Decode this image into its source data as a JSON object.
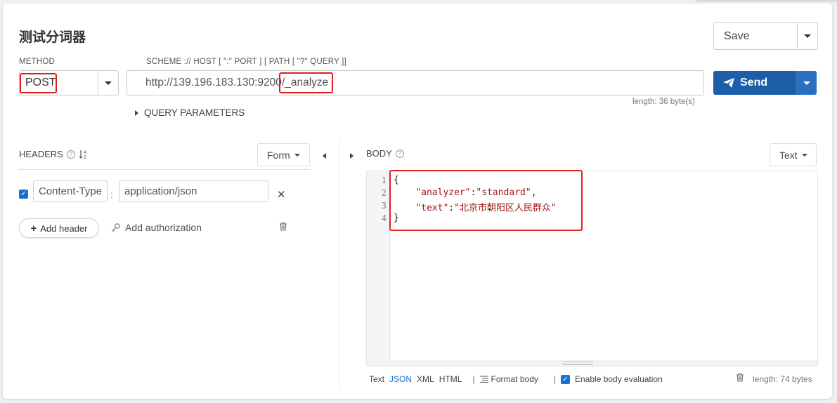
{
  "page": {
    "title": "测试分词器"
  },
  "save": {
    "label": "Save"
  },
  "method": {
    "label": "METHOD",
    "value": "POST"
  },
  "url": {
    "label": "SCHEME :// HOST [ \":\" PORT ] [ PATH [ \"?\" QUERY ]]",
    "host": "http://139.196.183.130:9200",
    "path": "/_analyze",
    "length": "length: 36 byte(s)"
  },
  "send": {
    "label": "Send"
  },
  "query_params": {
    "label": "QUERY PARAMETERS"
  },
  "headers": {
    "label": "HEADERS",
    "mode": "Form",
    "items": [
      {
        "name": "Content-Type",
        "value": "application/json",
        "enabled": true
      }
    ],
    "add_header": "Add header",
    "add_auth": "Add authorization"
  },
  "body": {
    "label": "BODY",
    "mode": "Text",
    "lines": [
      {
        "no": "1",
        "text": "{"
      },
      {
        "no": "2",
        "key": "\"analyzer\"",
        "sep": ":",
        "val": "\"standard\"",
        "tail": ","
      },
      {
        "no": "3",
        "key": "\"text\"",
        "sep": ":",
        "val": "\"北京市朝阳区人民群众\"",
        "tail": ""
      },
      {
        "no": "4",
        "text": "}"
      }
    ],
    "formats": [
      "Text",
      "JSON",
      "XML",
      "HTML"
    ],
    "active_format": "JSON",
    "format_body": "Format body",
    "enable_eval": "Enable body evaluation",
    "length": "length: 74 bytes"
  },
  "colors": {
    "accent": "#1c5ea8",
    "highlight": "#e02020",
    "link": "#1c6fd0"
  },
  "icons": [
    "caret-down-icon",
    "paper-plane-icon",
    "caret-right-icon",
    "caret-left-icon",
    "help-icon",
    "sort-az-icon",
    "close-icon",
    "plus-icon",
    "key-icon",
    "trash-icon",
    "format-icon",
    "checkbox-icon"
  ]
}
